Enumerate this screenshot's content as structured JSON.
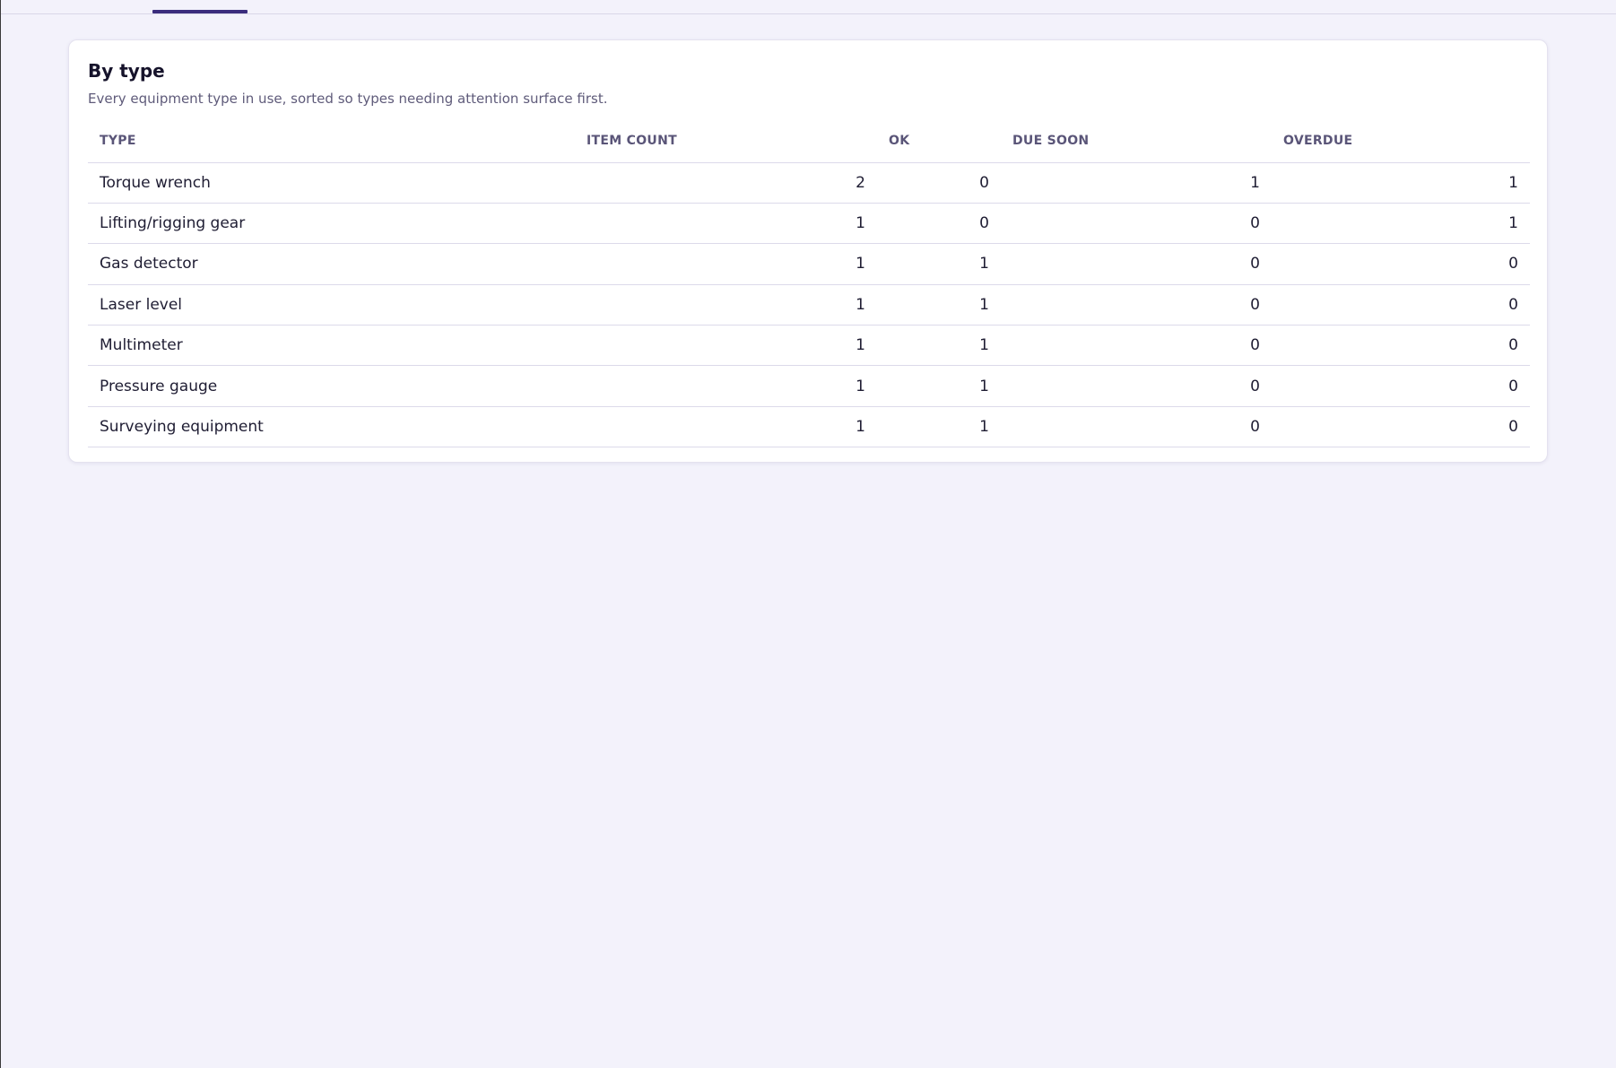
{
  "card": {
    "title": "By type",
    "subtitle": "Every equipment type in use, sorted so types needing attention surface first."
  },
  "table": {
    "headers": [
      "TYPE",
      "ITEM COUNT",
      "OK",
      "DUE SOON",
      "OVERDUE"
    ],
    "rows": [
      {
        "type": "Torque wrench",
        "item_count": "2",
        "ok": "0",
        "due_soon": "1",
        "overdue": "1"
      },
      {
        "type": "Lifting/rigging gear",
        "item_count": "1",
        "ok": "0",
        "due_soon": "0",
        "overdue": "1"
      },
      {
        "type": "Gas detector",
        "item_count": "1",
        "ok": "1",
        "due_soon": "0",
        "overdue": "0"
      },
      {
        "type": "Laser level",
        "item_count": "1",
        "ok": "1",
        "due_soon": "0",
        "overdue": "0"
      },
      {
        "type": "Multimeter",
        "item_count": "1",
        "ok": "1",
        "due_soon": "0",
        "overdue": "0"
      },
      {
        "type": "Pressure gauge",
        "item_count": "1",
        "ok": "1",
        "due_soon": "0",
        "overdue": "0"
      },
      {
        "type": "Surveying equipment",
        "item_count": "1",
        "ok": "1",
        "due_soon": "0",
        "overdue": "0"
      }
    ]
  },
  "colors": {
    "page_background": "#f3f2fb",
    "accent": "#3b2d7d",
    "header_text": "#5a5578",
    "row_divider": "#dcdaea"
  }
}
